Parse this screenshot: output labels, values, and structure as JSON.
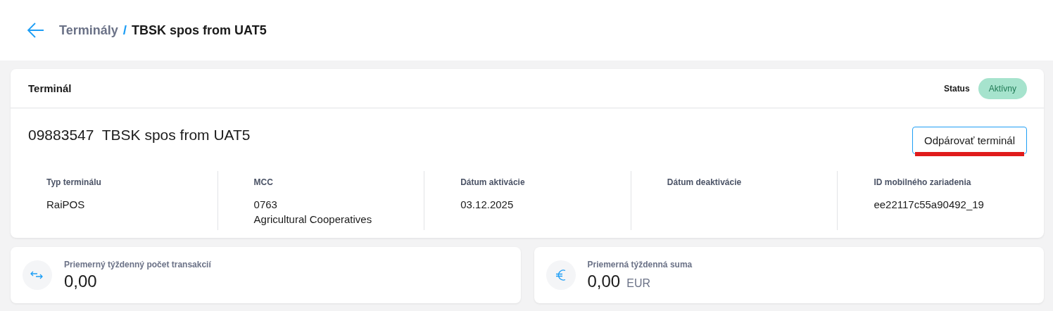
{
  "breadcrumb": {
    "parent": "Terminály",
    "separator": "/",
    "current": "TBSK spos from UAT5"
  },
  "terminal_card": {
    "title": "Terminál",
    "status_label": "Status",
    "status": "Aktívny",
    "name": "09883547  TBSK spos from UAT5",
    "unpair_button": "Odpárovať terminál",
    "fields": [
      {
        "label": "Typ terminálu",
        "lines": [
          "RaiPOS"
        ]
      },
      {
        "label": "MCC",
        "lines": [
          "0763",
          "Agricultural Cooperatives"
        ]
      },
      {
        "label": "Dátum aktivácie",
        "lines": [
          "03.12.2025"
        ]
      },
      {
        "label": "Dátum deaktivácie"
      },
      {
        "label": "ID mobilného zariadenia",
        "lines": [
          "ee22117c55a90492_19"
        ]
      }
    ]
  },
  "stats": [
    {
      "kind": "transactions",
      "label": "Priemerný týždenný počet transakcií",
      "value": "0,00"
    },
    {
      "kind": "amount",
      "label": "Priemerná týždenná suma",
      "value": "0,00",
      "unit": "EUR"
    }
  ]
}
